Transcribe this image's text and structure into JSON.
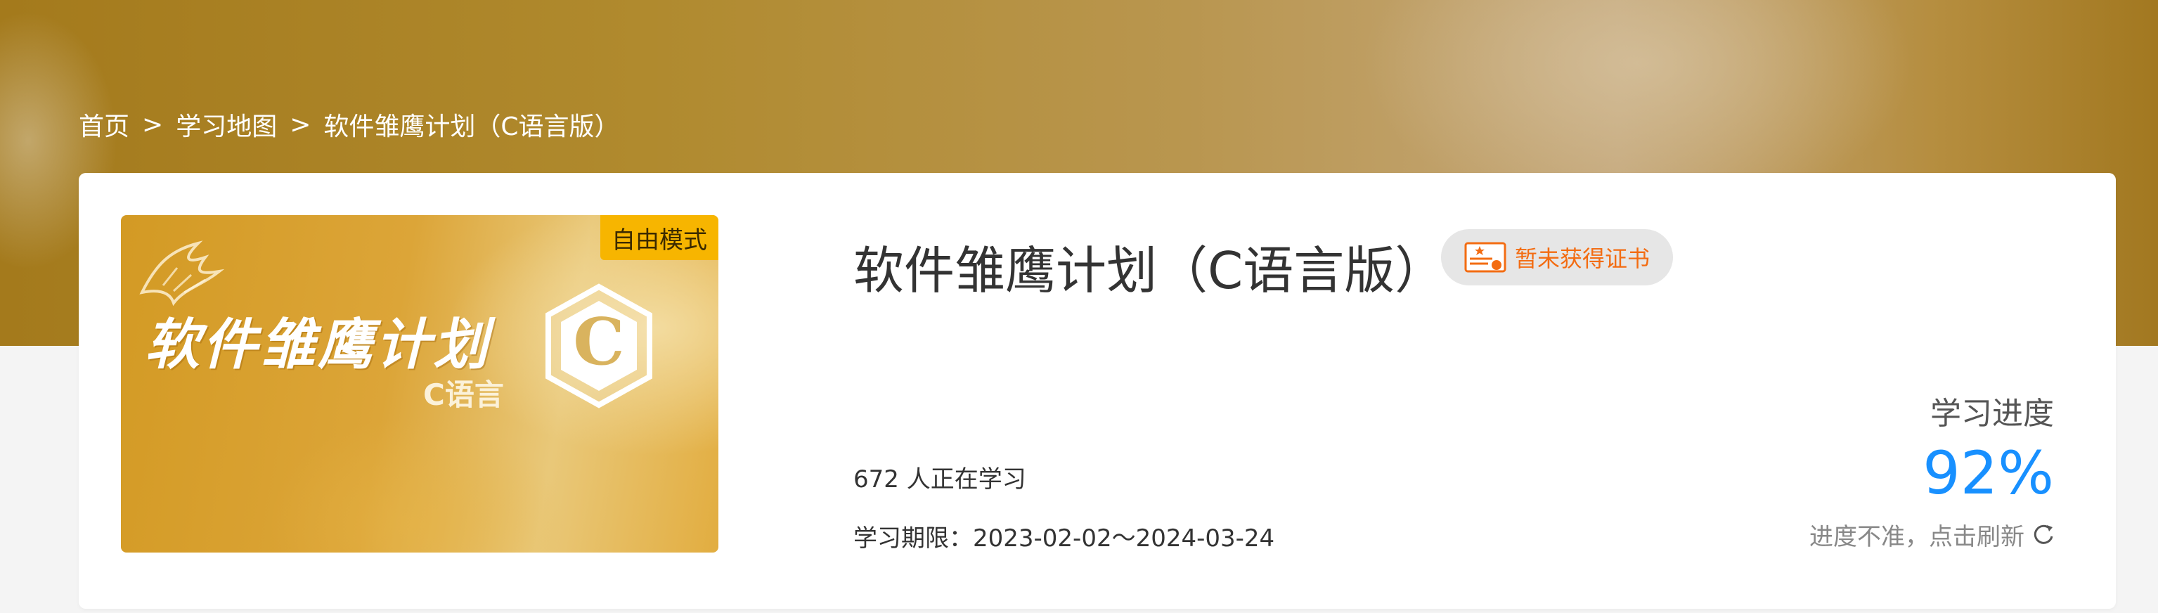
{
  "breadcrumb": {
    "home": "首页",
    "sep1": ">",
    "map": "学习地图",
    "sep2": ">",
    "current": "软件雏鹰计划（C语言版）"
  },
  "course": {
    "title": "软件雏鹰计划（C语言版）",
    "cover_mode": "自由模式",
    "cover_title": "软件雏鹰计划",
    "cover_subtitle": "C语言",
    "cover_hex_letter": "C",
    "certificate_status": "暂未获得证书",
    "learners": "672 人正在学习",
    "period": "学习期限：2023-02-02～2024-03-24"
  },
  "progress": {
    "label": "学习进度",
    "value": "92%",
    "refresh_text": "进度不准，点击刷新"
  },
  "icons": {
    "certificate": "certificate-icon",
    "refresh": "refresh-icon"
  },
  "colors": {
    "accent_blue": "#1890ff",
    "cert_orange": "#f36c12",
    "mode_tag": "#f7b500"
  }
}
